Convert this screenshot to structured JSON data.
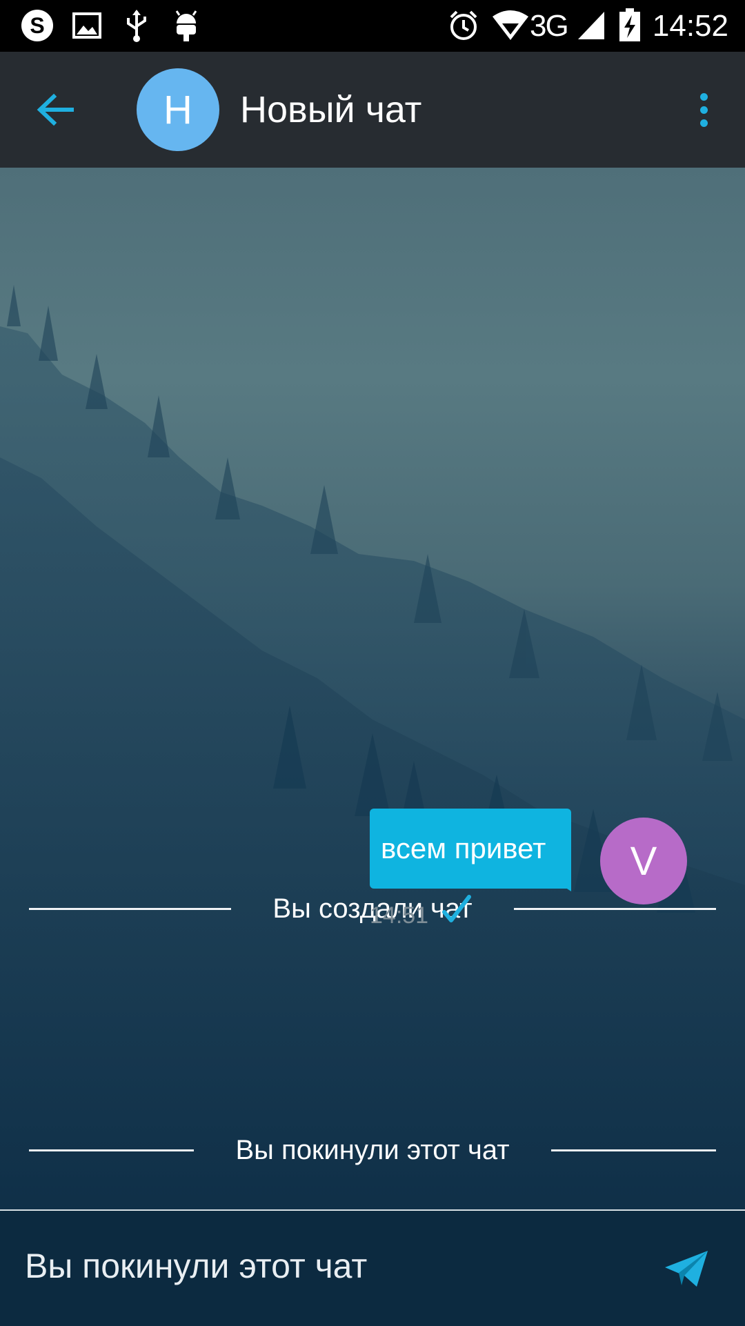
{
  "status_bar": {
    "network": "3G",
    "time": "14:52",
    "icons": [
      "skype-icon",
      "image-icon",
      "usb-icon",
      "android-icon",
      "alarm-icon",
      "wifi-icon",
      "signal-icon",
      "battery-charging-icon"
    ]
  },
  "header": {
    "avatar_letter": "Н",
    "title": "Новый чат",
    "back_icon": "arrow-left-icon",
    "menu_icon": "more-vert-icon"
  },
  "chat": {
    "system_messages": [
      {
        "text": "Вы создали чат"
      },
      {
        "text": "Вы покинули этот чат"
      }
    ],
    "messages": [
      {
        "text": "всем привет",
        "time": "14:51",
        "status_icon": "check-icon",
        "avatar_letter": "V"
      }
    ]
  },
  "composer": {
    "text": "Вы покинули этот чат",
    "send_icon": "send-icon"
  },
  "colors": {
    "accent": "#1fb0e0",
    "bubble": "#0fb4e0",
    "header_bg": "#272c31",
    "avatar_header": "#66b6f0",
    "avatar_user": "#b76bc8"
  }
}
